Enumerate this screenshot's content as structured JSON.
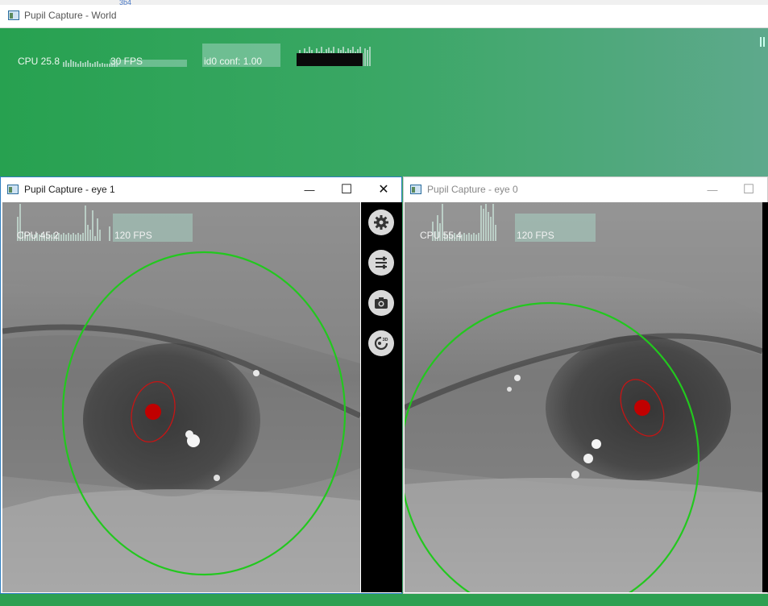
{
  "world": {
    "title": "Pupil Capture - World",
    "tab_fragment": "3b4",
    "cpu_label": "CPU 25.8",
    "fps_label": "30 FPS",
    "conf_label": "id0 conf: 1.00"
  },
  "eye1": {
    "title": "Pupil Capture - eye 1",
    "cpu_label": "CPU 45.2",
    "fps_label": "120 FPS",
    "minimize_glyph": "—",
    "maximize_glyph": "☐",
    "close_glyph": "✕",
    "sidebar_icons": [
      "gear-icon",
      "sliders-icon",
      "camera-icon",
      "3d-model-icon"
    ],
    "model_badge": "3D"
  },
  "eye0": {
    "title": "Pupil Capture - eye 0",
    "cpu_label": "CPU 55.4",
    "fps_label": "120 FPS",
    "minimize_glyph": "—",
    "maximize_glyph": "☐"
  },
  "colors": {
    "world_bg_left": "#27a150",
    "world_bg_right": "#5ea98c",
    "eye_model_circle": "#22c81e",
    "pupil_ellipse": "#c81414",
    "pupil_center": "#c00000",
    "active_window_border": "#2f7fc1"
  }
}
